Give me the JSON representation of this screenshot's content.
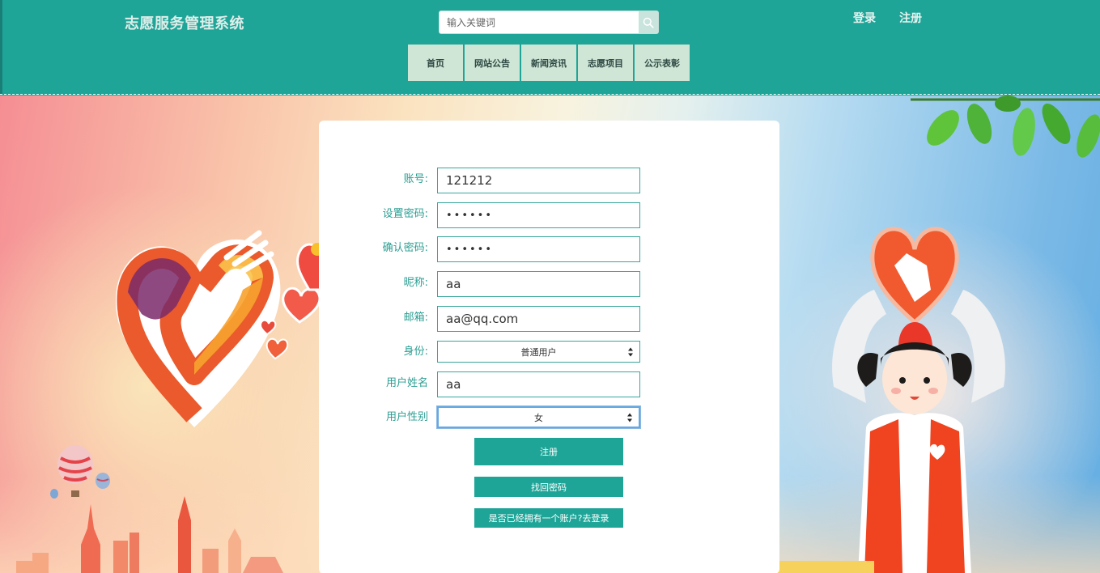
{
  "header": {
    "title": "志愿服务管理系统",
    "search_placeholder": "输入关键词",
    "login_label": "登录",
    "register_label": "注册"
  },
  "nav": {
    "items": [
      {
        "label": "首页"
      },
      {
        "label": "网站公告"
      },
      {
        "label": "新闻资讯"
      },
      {
        "label": "志愿项目"
      },
      {
        "label": "公示表彰"
      }
    ]
  },
  "form": {
    "account_label": "账号:",
    "account_value": "121212",
    "password_label": "设置密码:",
    "password_value": "••••••",
    "confirm_label": "确认密码:",
    "confirm_value": "••••••",
    "nickname_label": "昵称:",
    "nickname_value": "aa",
    "email_label": "邮箱:",
    "email_value": "aa@qq.com",
    "identity_label": "身份:",
    "identity_value": "普通用户",
    "username_label": "用户姓名",
    "username_value": "aa",
    "gender_label": "用户性别",
    "gender_value": "女",
    "register_button": "注册",
    "recover_button": "找回密码",
    "login_link_button": "是否已经拥有一个账户?去登录"
  },
  "colors": {
    "primary": "#1fa598",
    "nav_bg": "#cfe5d6",
    "field_border": "#38a79c",
    "label_text": "#2b9e92"
  }
}
